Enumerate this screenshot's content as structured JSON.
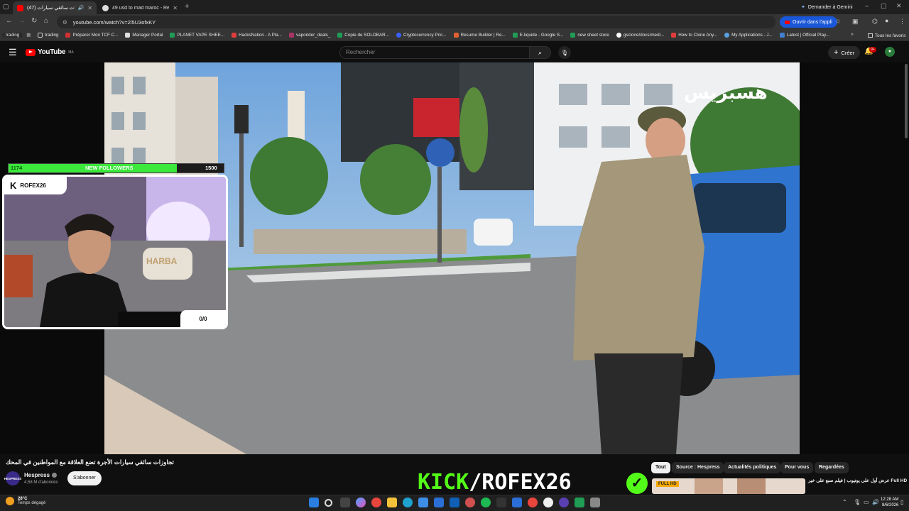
{
  "browser": {
    "tabs": [
      {
        "title": "(47) تجاوزات سائقي سيارات",
        "favicon_color": "#ff0000",
        "active": true
      },
      {
        "title": "49 usd to mad maroc - Recherc",
        "favicon_color": "#dddddd",
        "active": false
      }
    ],
    "gemini_button": "Demander à Gemini",
    "url": "youtube.com/watch?v=2l5U3ofxKY",
    "open_app_button": "Ouvrir dans l'appli",
    "bookmarks": [
      {
        "label": "trading",
        "color": "#444444"
      },
      {
        "label": "Préparer Mon TCF C...",
        "color": "#d03030"
      },
      {
        "label": "Manager Portal",
        "color": "#e0e0e0"
      },
      {
        "label": "PLANET VAPE SHEE...",
        "color": "#1f9d55"
      },
      {
        "label": "HacksNation - A Pla...",
        "color": "#e03c3c"
      },
      {
        "label": "vaporider_deals_",
        "color": "#aa3366"
      },
      {
        "label": "Copie de SOLOBAR...",
        "color": "#1f9d55"
      },
      {
        "label": "Cryptocurrency Pric...",
        "color": "#3860ff"
      },
      {
        "label": "Resume Builder | Re...",
        "color": "#e06030"
      },
      {
        "label": "E-liquide - Google S...",
        "color": "#1f9d55"
      },
      {
        "label": "new sheet store",
        "color": "#1f9d55"
      },
      {
        "label": "gsclone/docs/medi...",
        "color": "#ffffff"
      },
      {
        "label": "How to Clone Any...",
        "color": "#e03c3c"
      },
      {
        "label": "My Applications - J...",
        "color": "#5aa0e0"
      },
      {
        "label": "Latest | Official Play...",
        "color": "#4080d0"
      }
    ],
    "all_favorites": "Tous les favoris"
  },
  "youtube": {
    "logo_text": "YouTube",
    "region": "MA",
    "search_placeholder": "Rechercher",
    "create_label": "Créer",
    "notification_count": "9+",
    "video_title": "تجاوزات سائقي سيارات الأجرة تضع العلاقة مع المواطنين في المحك",
    "watermark": "هسبريس",
    "channel": {
      "name": "Hespress",
      "subscribers": "4,58 M d'abonnés",
      "avatar_text": "HESPRESS"
    },
    "subscribe_label": "S'abonner",
    "chips": [
      "Tout",
      "Source : Hespress",
      "Actualités politiques",
      "Pour vous",
      "Regardées"
    ],
    "recommendation": {
      "title": "عرض أول على يوتيوب | فيلم صنع على خير Full HD",
      "badge": "FULL HD"
    }
  },
  "stream_overlay": {
    "followers_current": 1174,
    "followers_goal": 1500,
    "followers_label": "NEW FOLLOWERS",
    "streamer_name": "ROFEX26",
    "sub_goal": "0/0",
    "kick_prefix": "KICK",
    "kick_handle": "/ROFEX26",
    "cushion_text": "HARBA"
  },
  "taskbar": {
    "temperature": "28°C",
    "weather_text": "Temps dégagé",
    "time": "12:28 AM",
    "date": "8/6/2026",
    "apps": [
      "windows-start",
      "search",
      "task-view",
      "copilot",
      "chrome",
      "file-explorer",
      "edge",
      "store",
      "mail",
      "outlook",
      "chatgpt",
      "spotify",
      "capcut",
      "vs-code",
      "chrome-profile",
      "github",
      "obs",
      "app-green",
      "app-gray"
    ]
  }
}
